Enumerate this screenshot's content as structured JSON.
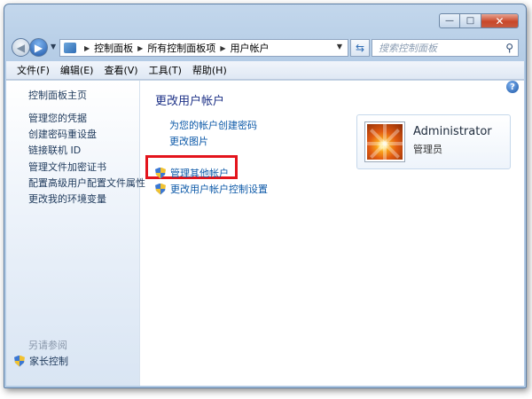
{
  "window": {
    "buttons": {
      "minimize": "—",
      "maximize": "□",
      "close": "✕"
    }
  },
  "address": {
    "crumbs": [
      "控制面板",
      "所有控制面板项",
      "用户帐户"
    ],
    "search_placeholder": "搜索控制面板"
  },
  "menu": [
    "文件(F)",
    "编辑(E)",
    "查看(V)",
    "工具(T)",
    "帮助(H)"
  ],
  "sidebar": {
    "home": "控制面板主页",
    "links": [
      "管理您的凭据",
      "创建密码重设盘",
      "链接联机 ID",
      "管理文件加密证书",
      "配置高级用户配置文件属性",
      "更改我的环境变量"
    ],
    "see_also": "另请参阅",
    "parental": "家长控制"
  },
  "main": {
    "title": "更改用户帐户",
    "links": [
      "为您的帐户创建密码",
      "更改图片"
    ],
    "shield_links": [
      "管理其他帐户",
      "更改用户帐户控制设置"
    ],
    "help": "?"
  },
  "account": {
    "name": "Administrator",
    "role": "管理员"
  }
}
